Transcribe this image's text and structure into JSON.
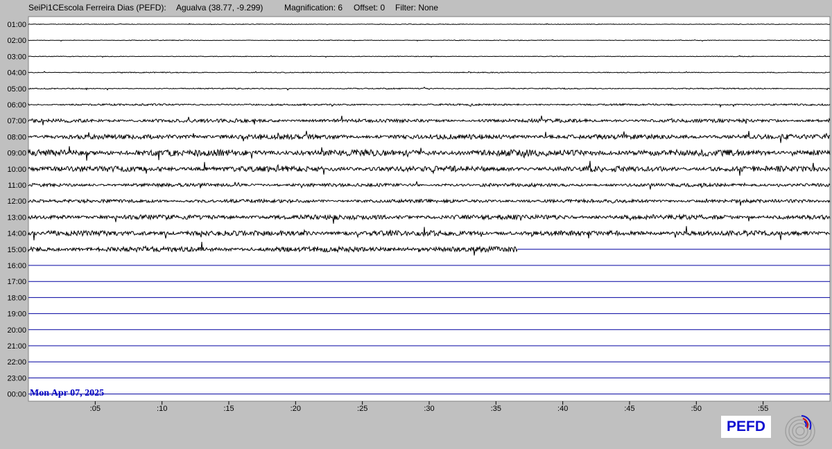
{
  "header": {
    "station": "SeiPi1CEscola Ferreira Dias (PEFD):",
    "location": "Agualva (38.77, -9.299)",
    "magnification": "Magnification: 6",
    "offset": "Offset: 0",
    "filter": "Filter: None"
  },
  "chart_data": {
    "type": "line",
    "title": "",
    "date_label": "Mon Apr 07, 2025",
    "hour_labels": [
      "01:00",
      "02:00",
      "03:00",
      "04:00",
      "05:00",
      "06:00",
      "07:00",
      "08:00",
      "09:00",
      "10:00",
      "11:00",
      "12:00",
      "13:00",
      "14:00",
      "15:00",
      "16:00",
      "17:00",
      "18:00",
      "19:00",
      "20:00",
      "21:00",
      "22:00",
      "23:00",
      "00:00"
    ],
    "x_tick_labels": [
      ":05",
      ":10",
      ":15",
      ":20",
      ":25",
      ":30",
      ":35",
      ":40",
      ":45",
      ":50",
      ":55"
    ],
    "x_range_minutes": [
      0,
      60
    ],
    "recorded_until_minute": 36.6,
    "recorded_rows": 15,
    "noise_level_by_hour": [
      0.3,
      0.3,
      0.3,
      0.4,
      0.5,
      0.8,
      1.6,
      2.2,
      3.0,
      2.6,
      1.6,
      1.6,
      2.2,
      2.4,
      2.4,
      0,
      0,
      0,
      0,
      0,
      0,
      0,
      0,
      0
    ],
    "trace_colors": {
      "recorded": "#000000",
      "empty": "#0000a0"
    }
  },
  "logo": {
    "text": "PEFD"
  }
}
